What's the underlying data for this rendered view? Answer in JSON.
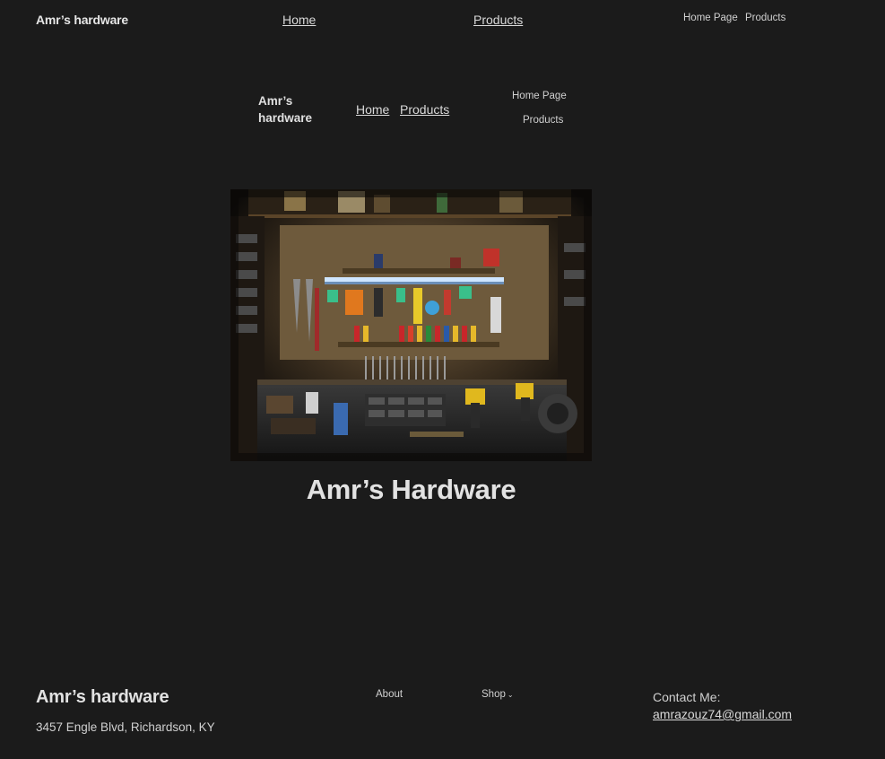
{
  "header": {
    "site_title": "Amr’s hardware",
    "nav": [
      {
        "label": "Home"
      },
      {
        "label": "Products"
      }
    ],
    "secondary_nav": [
      {
        "label": "Home Page"
      },
      {
        "label": "Products"
      }
    ]
  },
  "inner_header": {
    "site_title": "Amr’s hardware",
    "nav": [
      {
        "label": "Home"
      },
      {
        "label": "Products"
      }
    ],
    "secondary_nav": [
      {
        "label": "Home Page"
      },
      {
        "label": "Products"
      }
    ]
  },
  "hero": {
    "image_icon": "workshop-tools-photo",
    "title": "Amr’s Hardware"
  },
  "footer": {
    "site_title": "Amr’s hardware",
    "address": "3457 Engle Blvd, Richardson, KY",
    "links": [
      {
        "label": "About"
      },
      {
        "label": "Shop"
      }
    ],
    "contact_label": "Contact Me:",
    "contact_email": "amrazouz74@gmail.com"
  },
  "colors": {
    "background": "#1b1b1b",
    "text": "#d9d9d9"
  }
}
